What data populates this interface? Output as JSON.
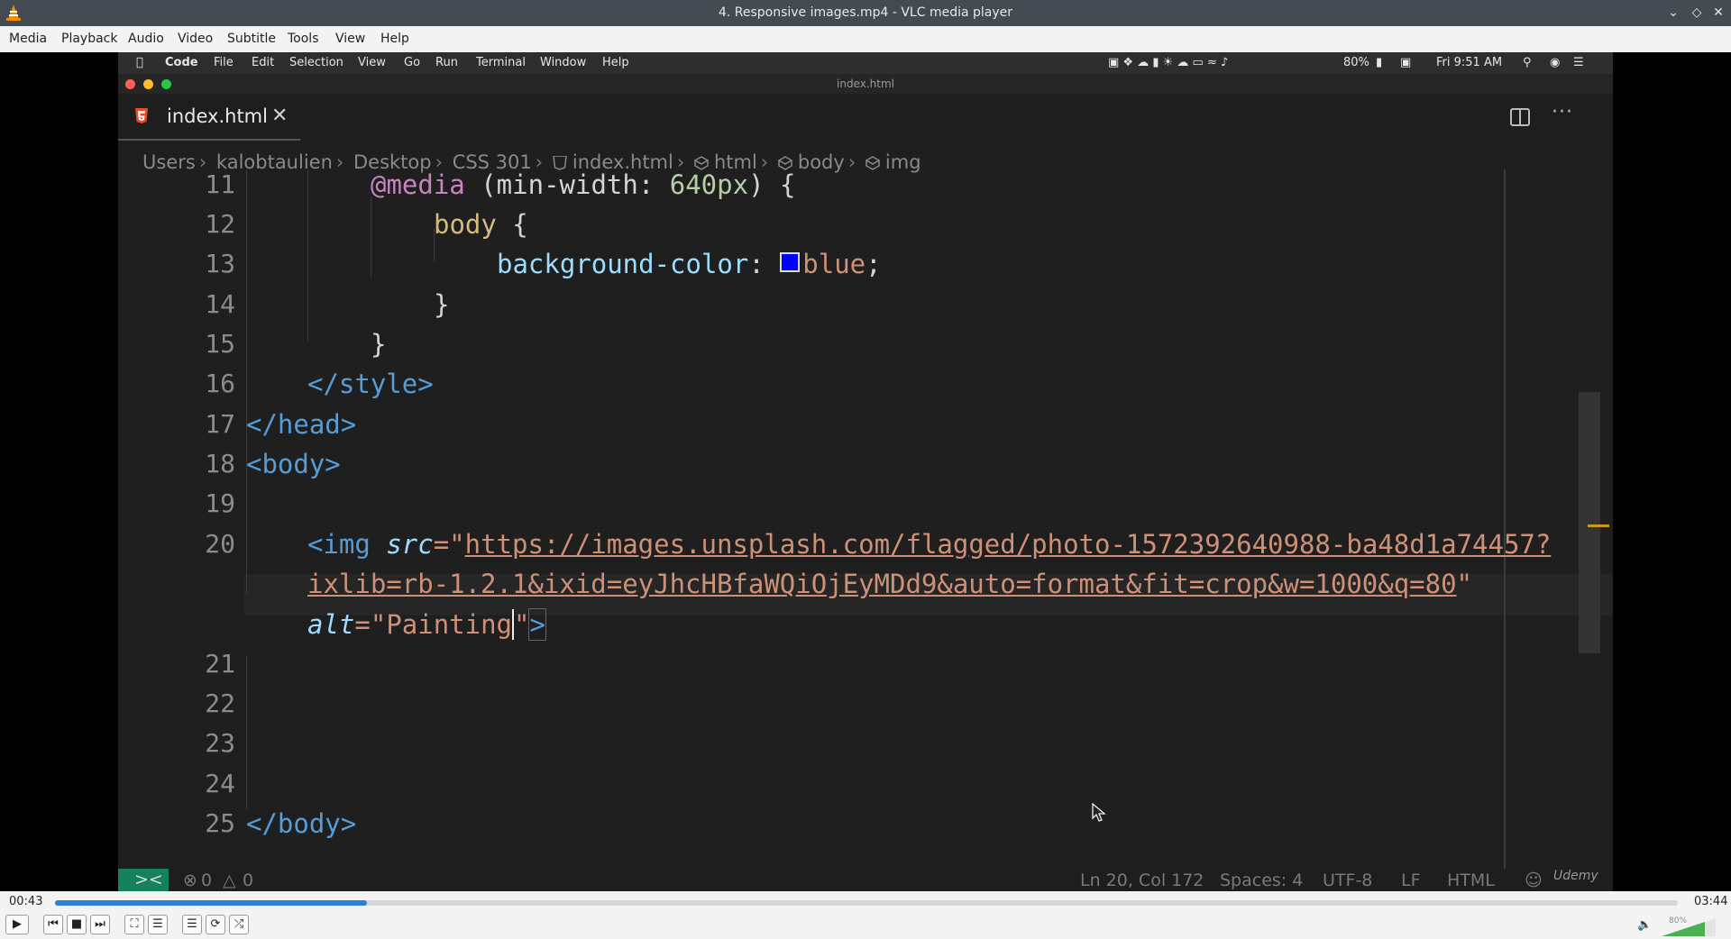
{
  "window": {
    "title": "4. Responsive images.mp4 - VLC media player"
  },
  "menu": [
    "Media",
    "Playback",
    "Audio",
    "Video",
    "Subtitle",
    "Tools",
    "View",
    "Help"
  ],
  "mac_menubar": {
    "items": [
      "Code",
      "File",
      "Edit",
      "Selection",
      "View",
      "Go",
      "Run",
      "Terminal",
      "Window",
      "Help"
    ],
    "battery": "80%",
    "clock": "Fri 9:51 AM"
  },
  "editor_window_title": "index.html",
  "tab": {
    "name": "index.html"
  },
  "breadcrumbs": [
    "Users",
    "kalobtaulien",
    "Desktop",
    "CSS 301",
    "index.html",
    "html",
    "body",
    "img"
  ],
  "code_lines": [
    {
      "num": "11",
      "text": "@media (min-width: 640px) {"
    },
    {
      "num": "12",
      "text": "body {"
    },
    {
      "num": "13",
      "text": "background-color: blue;"
    },
    {
      "num": "14",
      "text": "}"
    },
    {
      "num": "15",
      "text": "}"
    },
    {
      "num": "16",
      "text": "</style>"
    },
    {
      "num": "17",
      "text": "</head>"
    },
    {
      "num": "18",
      "text": "<body>"
    },
    {
      "num": "19",
      "text": ""
    },
    {
      "num": "20",
      "text": "<img src=\"https://images.unsplash.com/flagged/photo-1572392640988-ba48d1a74457?ixlib=rb-1.2.1&ixid=eyJhcHBfaWQiOjEyMDd9&auto=format&fit=crop&w=1000&q=80\" alt=\"Painting\">"
    },
    {
      "num": "21",
      "text": ""
    },
    {
      "num": "22",
      "text": ""
    },
    {
      "num": "23",
      "text": ""
    },
    {
      "num": "24",
      "text": ""
    },
    {
      "num": "25",
      "text": "</body>"
    }
  ],
  "code_tokens": {
    "media_kw": "@media",
    "media_open": " (min-width: ",
    "media_num": "640px",
    "media_close": ") {",
    "body_sel": "body",
    "body_brace": " {",
    "prop": "background-color",
    "colon": ": ",
    "blue": "blue",
    "semi": ";",
    "close_brace": "}",
    "style_close": "</style>",
    "head_close": "</head>",
    "body_open": "<body>",
    "img_tag": "<img",
    "src_attr": "src",
    "eq_quote": "=\"",
    "url_part1": "https://images.unsplash.com/flagged/photo-1572392640988-ba48d1a74457?",
    "url_part2": "ixlib=rb-1.2.1&ixid=eyJhcHBfaWQiOjEyMDd9&auto=format&fit=crop&w=1000&q=80",
    "quote": "\"",
    "alt_attr": "alt",
    "alt_val": "Painting",
    "tag_end": ">",
    "body_close": "</body>"
  },
  "status": {
    "errors": "0",
    "warnings": "0",
    "position": "Ln 20, Col 172",
    "spaces": "Spaces: 4",
    "encoding": "UTF-8",
    "eol": "LF",
    "language": "HTML",
    "watermark": "Udemy"
  },
  "player": {
    "elapsed": "00:43",
    "total": "03:44",
    "progress_fraction": 0.192,
    "volume": "80%"
  },
  "colors": {
    "accent": "#2f7ed8",
    "remote": "#16825d"
  }
}
